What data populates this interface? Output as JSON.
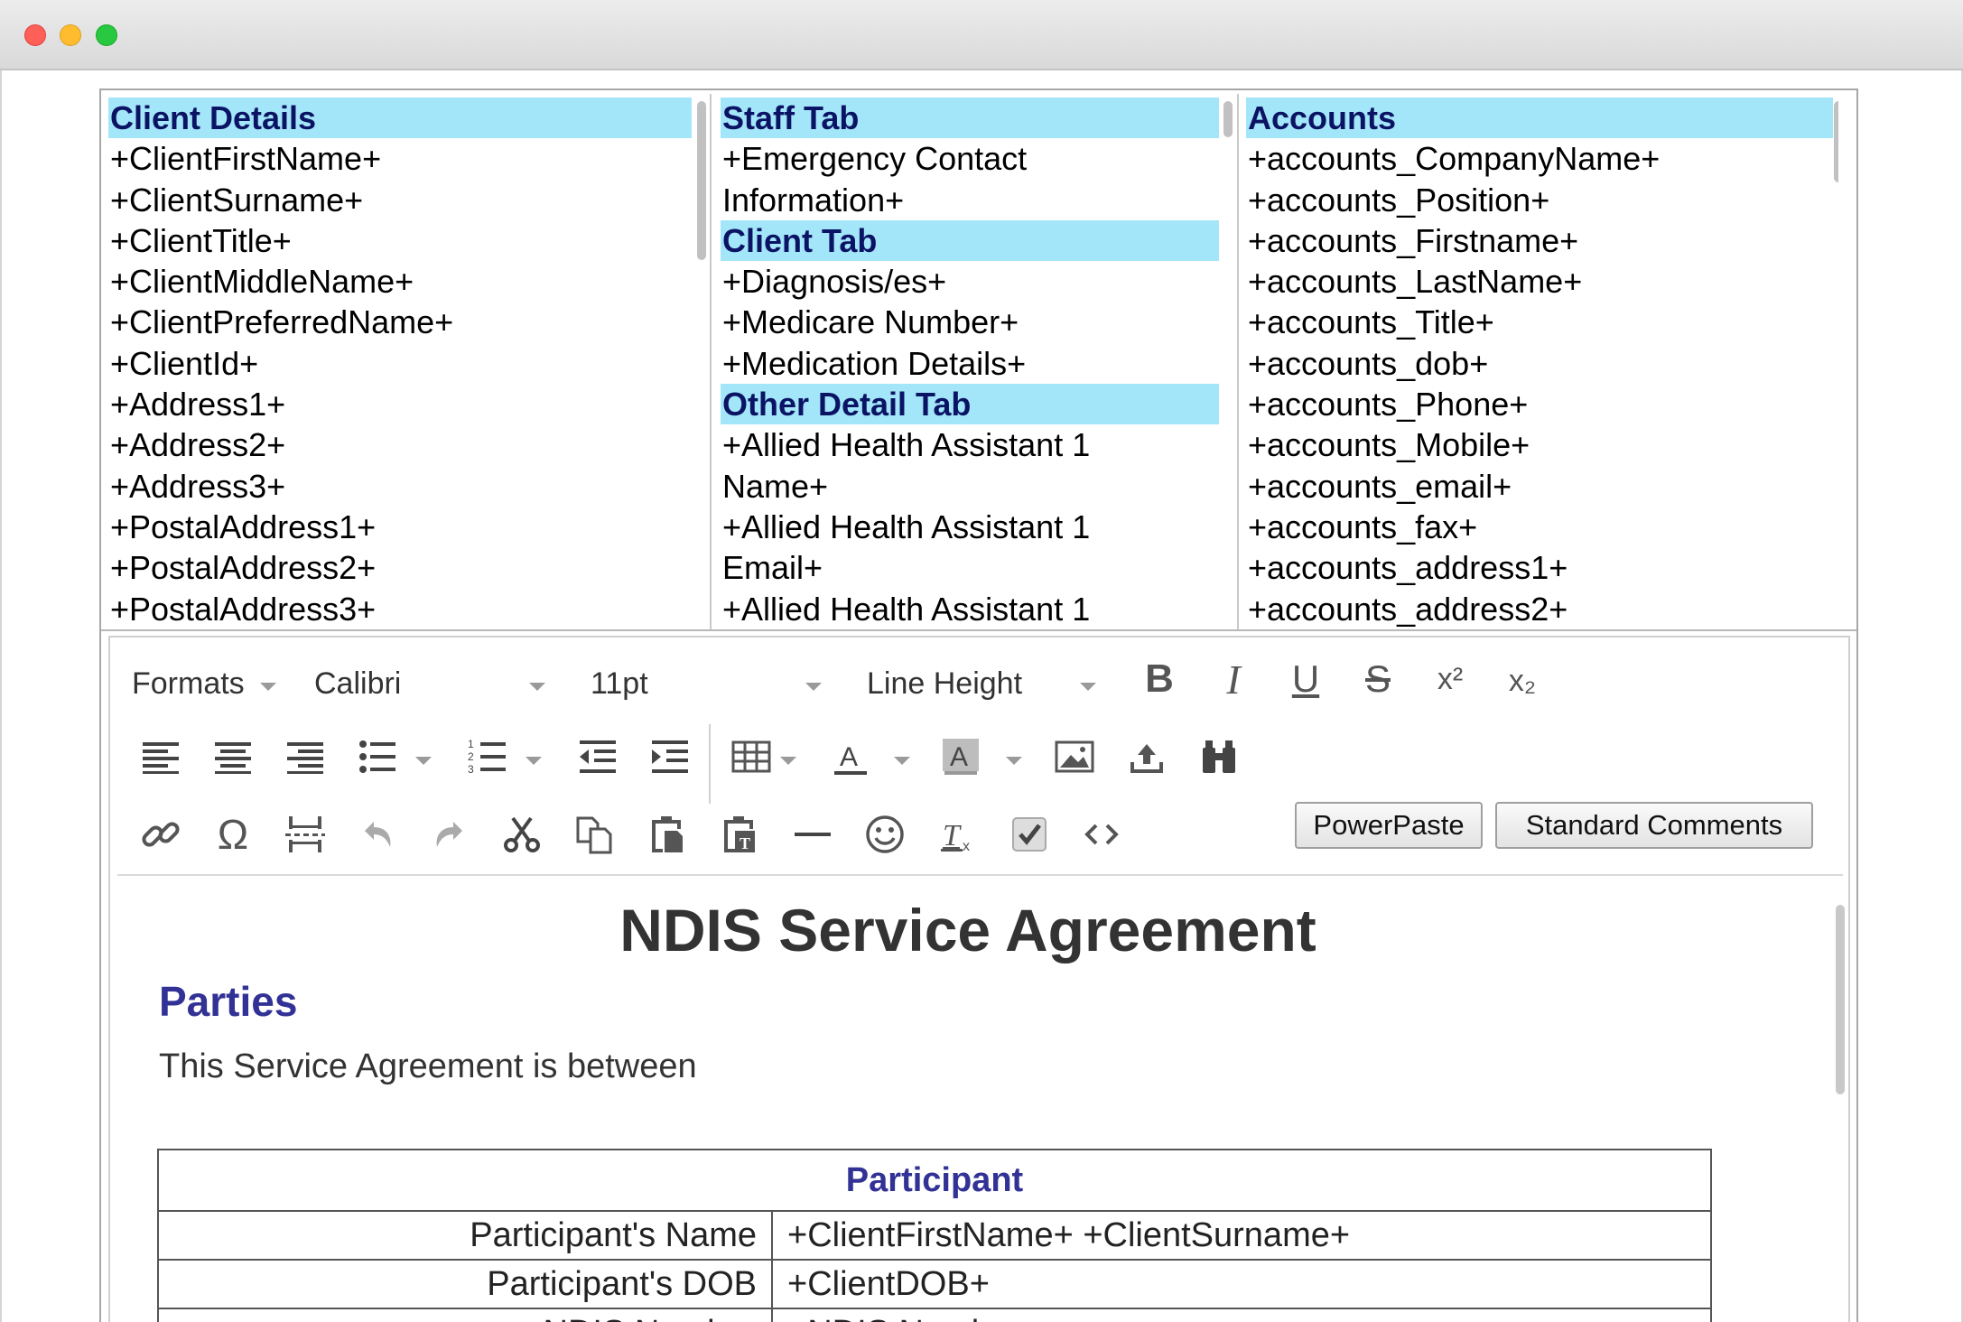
{
  "client_details": {
    "heading": "Client Details",
    "fields": [
      "+ClientFirstName+",
      "+ClientSurname+",
      "+ClientTitle+",
      "+ClientMiddleName+",
      "+ClientPreferredName+",
      "+ClientId+",
      "+Address1+",
      "+Address2+",
      "+Address3+",
      "+PostalAddress1+",
      "+PostalAddress2+",
      "+PostalAddress3+"
    ]
  },
  "tabs_column": {
    "staff_heading": "Staff Tab",
    "staff_fields": [
      "+Emergency Contact",
      "Information+"
    ],
    "client_heading": "Client Tab",
    "client_fields": [
      "+Diagnosis/es+",
      "+Medicare Number+",
      "+Medication Details+"
    ],
    "other_heading": "Other Detail Tab",
    "other_fields": [
      "+Allied Health Assistant 1",
      "Name+",
      "+Allied Health Assistant 1",
      "Email+",
      "+Allied Health Assistant 1"
    ]
  },
  "accounts": {
    "heading": "Accounts",
    "fields": [
      "+accounts_CompanyName+",
      "+accounts_Position+",
      "+accounts_Firstname+",
      "+accounts_LastName+",
      "+accounts_Title+",
      "+accounts_dob+",
      "+accounts_Phone+",
      "+accounts_Mobile+",
      "+accounts_email+",
      "+accounts_fax+",
      "+accounts_address1+",
      "+accounts_address2+"
    ]
  },
  "toolbar": {
    "formats": "Formats",
    "font_family": "Calibri",
    "font_size": "11pt",
    "line_height": "Line Height",
    "powerpaste": "PowerPaste",
    "standard_comments": "Standard Comments",
    "icons": [
      "bold-icon",
      "italic-icon",
      "underline-icon",
      "strikethrough-icon",
      "superscript-icon",
      "subscript-icon",
      "align-left-icon",
      "align-center-icon",
      "align-right-icon",
      "bullet-list-icon",
      "numbered-list-icon",
      "outdent-icon",
      "indent-icon",
      "table-icon",
      "text-color-icon",
      "background-color-icon",
      "image-icon",
      "upload-icon",
      "find-replace-icon",
      "link-icon",
      "special-char-icon",
      "page-break-icon",
      "undo-icon",
      "redo-icon",
      "cut-icon",
      "copy-icon",
      "paste-icon",
      "paste-text-icon",
      "horizontal-rule-icon",
      "emoticon-icon",
      "clear-format-icon",
      "checkbox-icon",
      "code-icon"
    ],
    "bold_glyph": "B",
    "italic_glyph": "I",
    "underline_glyph": "U",
    "strike_glyph": "S",
    "super_glyph": "x²",
    "sub_glyph": "x₂",
    "omega_glyph": "Ω"
  },
  "document": {
    "title": "NDIS Service Agreement",
    "section_heading": "Parties",
    "intro": "This Service Agreement is between",
    "table": {
      "header": "Participant",
      "rows": [
        {
          "label": "Participant's Name",
          "value": "+ClientFirstName+ +ClientSurname+"
        },
        {
          "label": "Participant's DOB",
          "value": "+ClientDOB+"
        },
        {
          "label": "NDIS Number",
          "value": "+NDIS Number+"
        }
      ]
    }
  }
}
